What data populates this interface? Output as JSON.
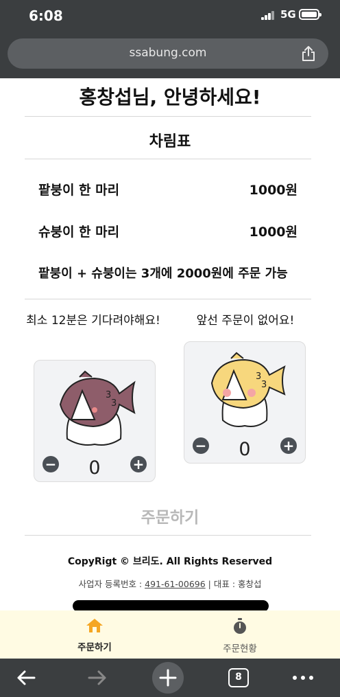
{
  "status": {
    "time": "6:08",
    "network": "5G"
  },
  "browser": {
    "url": "ssabung.com",
    "tab_count": "8"
  },
  "page": {
    "greeting": "홍창섭님, 안녕하세요!",
    "menu_title": "차림표",
    "items": [
      {
        "name": "팥붕이 한 마리",
        "price": "1000원"
      },
      {
        "name": "슈붕이 한 마리",
        "price": "1000원"
      }
    ],
    "combo_note": "팥붕이 + 슈붕이는 3개에 2000원에 주문 가능",
    "wait_message": "최소 12분은 기다려야해요!",
    "queue_message": "앞선 주문이 없어요!",
    "products": [
      {
        "name": "팥붕이",
        "count": "0",
        "color": "#8e5d6a"
      },
      {
        "name": "슈붕이",
        "count": "0",
        "color": "#f7d77d"
      }
    ],
    "order_button": "주문하기",
    "copyright": "CopyRigt © 브리도. All Rights Reserved",
    "biz_prefix": "사업자 등록번호 : ",
    "biz_number": "491-61-00696",
    "biz_suffix": " | 대표 : 홍창섭"
  },
  "tabbar": {
    "tabs": [
      {
        "label": "주문하기",
        "icon": "home-icon",
        "active": true
      },
      {
        "label": "주문현황",
        "icon": "stopwatch-icon",
        "active": false
      }
    ]
  },
  "colors": {
    "accent": "#f5a623",
    "tabbar_bg": "#fffbe3",
    "chrome": "#3b3e40"
  }
}
